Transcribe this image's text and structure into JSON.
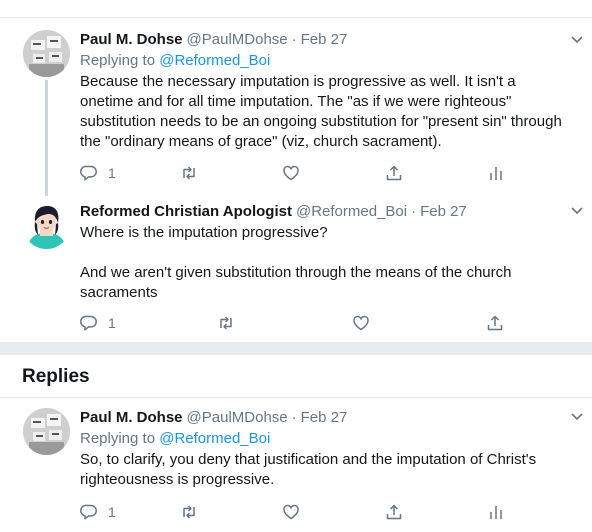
{
  "tweets": [
    {
      "name": "Paul M. Dohse",
      "handle": "@PaulMDohse",
      "date": "Feb 27",
      "replying_prefix": "Replying to ",
      "replying_to": "@Reformed_Boi",
      "text": "Because the necessary imputation is progressive as well. It isn't a onetime and for all time imputation. The \"as if we were righteous\" substitution needs to be an ongoing substitution for \"present sin\" through the \"ordinary means of grace\" (viz, church sacrament).",
      "reply_count": "1"
    },
    {
      "name": "Reformed Christian Apologist",
      "handle": "@Reformed_Boi",
      "date": "Feb 27",
      "text": "Where is the imputation progressive?\n\nAnd we aren't given substitution through the means of the church sacraments",
      "reply_count": "1"
    },
    {
      "name": "Paul M. Dohse",
      "handle": "@PaulMDohse",
      "date": "Feb 27",
      "replying_prefix": "Replying to ",
      "replying_to": "@Reformed_Boi",
      "text": "So, to clarify, you deny that justification and the imputation of Christ's righteousness is progressive.",
      "reply_count": "1"
    }
  ],
  "dot": "·",
  "replies_heading": "Replies",
  "icons": [
    "reply-icon",
    "retweet-icon",
    "like-icon",
    "share-icon",
    "analytics-icon",
    "chevron-down-icon"
  ],
  "colors": {
    "link": "#1b95e0",
    "muted": "#657786",
    "divider": "#e6ecf0"
  }
}
